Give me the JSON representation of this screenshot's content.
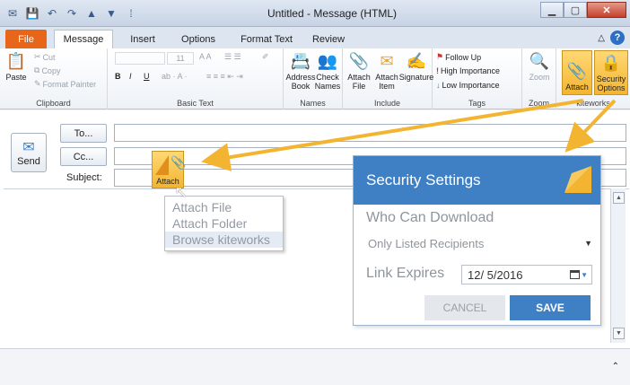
{
  "window": {
    "title": "Untitled - Message (HTML)"
  },
  "tabs": [
    {
      "label": "File"
    },
    {
      "label": "Message"
    },
    {
      "label": "Insert"
    },
    {
      "label": "Options"
    },
    {
      "label": "Format Text"
    },
    {
      "label": "Review"
    }
  ],
  "ribbon": {
    "clipboard": {
      "paste": "Paste",
      "cut": "Cut",
      "copy": "Copy",
      "format_painter": "Format Painter",
      "label": "Clipboard"
    },
    "basic_text": {
      "font_size": "11",
      "bold": "B",
      "italic": "I",
      "underline": "U",
      "label": "Basic Text"
    },
    "names": {
      "address_book": "Address\nBook",
      "check_names": "Check\nNames",
      "label": "Names"
    },
    "include": {
      "attach_file": "Attach\nFile",
      "attach_item": "Attach\nItem",
      "signature": "Signature",
      "label": "Include"
    },
    "tags": {
      "follow_up": "Follow Up",
      "high": "High Importance",
      "low": "Low Importance",
      "label": "Tags"
    },
    "zoom": {
      "label": "Zoom",
      "group": "Zoom"
    },
    "kiteworks": {
      "attach": "Attach",
      "security": "Security\nOptions",
      "label": "kiteworks"
    }
  },
  "compose": {
    "send": "Send",
    "to": "To...",
    "cc": "Cc...",
    "subject": "Subject:"
  },
  "attach_float": {
    "label": "Attach"
  },
  "dropdown": {
    "items": [
      {
        "label": "Attach File"
      },
      {
        "label": "Attach Folder"
      },
      {
        "label": "Browse kiteworks"
      }
    ]
  },
  "security": {
    "title": "Security Settings",
    "download_label": "Who Can Download",
    "download_value": "Only Listed Recipients",
    "expires_label": "Link Expires",
    "expires_value": "12/ 5/2016",
    "cancel": "CANCEL",
    "save": "SAVE"
  },
  "colors": {
    "accent": "#3f80c4",
    "highlight": "#f3b531",
    "file_tab": "#e8661a"
  }
}
